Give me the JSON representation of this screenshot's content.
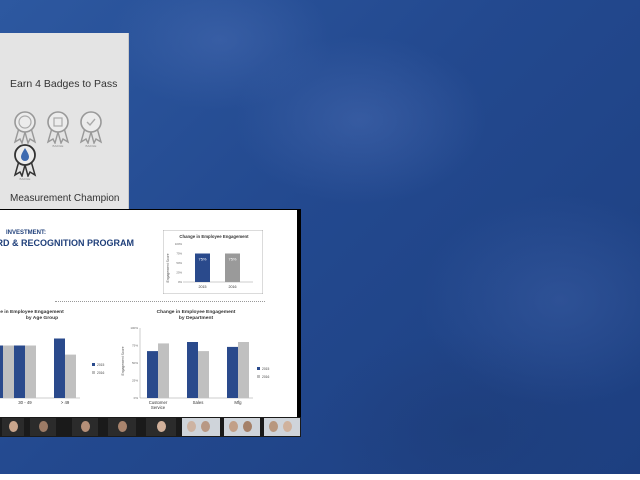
{
  "badge_card": {
    "title": "Earn 4 Badges to Pass",
    "badges": [
      {
        "caption": "BADGE",
        "icon": "ribbon-badge-icon"
      },
      {
        "caption": "BADGE",
        "icon": "ribbon-badge-icon"
      },
      {
        "caption": "BADGE",
        "icon": "ribbon-badge-icon"
      },
      {
        "caption": "BADGE",
        "icon": "water-drop-badge-icon"
      }
    ],
    "footer": "Measurement Champion"
  },
  "slide": {
    "title_line1": "INVESTMENT:",
    "title_line2": "WARD & RECOGNITION PROGRAM"
  },
  "chart_data": [
    {
      "type": "bar",
      "title": "Change in Employee Engagement",
      "ylabel": "Engagement Score",
      "categories": [
        "2015",
        "2016"
      ],
      "values": [
        75,
        75
      ],
      "data_labels": [
        "75%",
        "75%"
      ],
      "yticks": [
        "100%",
        "75%",
        "50%",
        "25%",
        "0%"
      ],
      "ylim": [
        0,
        100
      ],
      "colors": [
        "#2a4a8c",
        "#9a9a9a"
      ]
    },
    {
      "type": "bar",
      "title": "e in Employee Engagement",
      "subtitle": "by Age Group",
      "categories": [
        "",
        "30 - 49",
        "> 49"
      ],
      "series": [
        {
          "name": "2015",
          "values": [
            75,
            75,
            85
          ]
        },
        {
          "name": "2016",
          "values": [
            75,
            75,
            62
          ]
        }
      ],
      "ylim": [
        0,
        100
      ],
      "colors": [
        "#2a4a8c",
        "#c0c0c0"
      ]
    },
    {
      "type": "bar",
      "title": "Change in Employee Engagement",
      "subtitle": "by Department",
      "ylabel": "Engagement Score",
      "categories": [
        "Customer Service",
        "Sales",
        "Mfg"
      ],
      "series": [
        {
          "name": "2015",
          "values": [
            67,
            80,
            73
          ]
        },
        {
          "name": "2016",
          "values": [
            78,
            67,
            80
          ]
        }
      ],
      "yticks": [
        "100%",
        "75%",
        "50%",
        "25%",
        "0%"
      ],
      "ylim": [
        0,
        100
      ],
      "colors": [
        "#2a4a8c",
        "#c0c0c0"
      ]
    }
  ]
}
